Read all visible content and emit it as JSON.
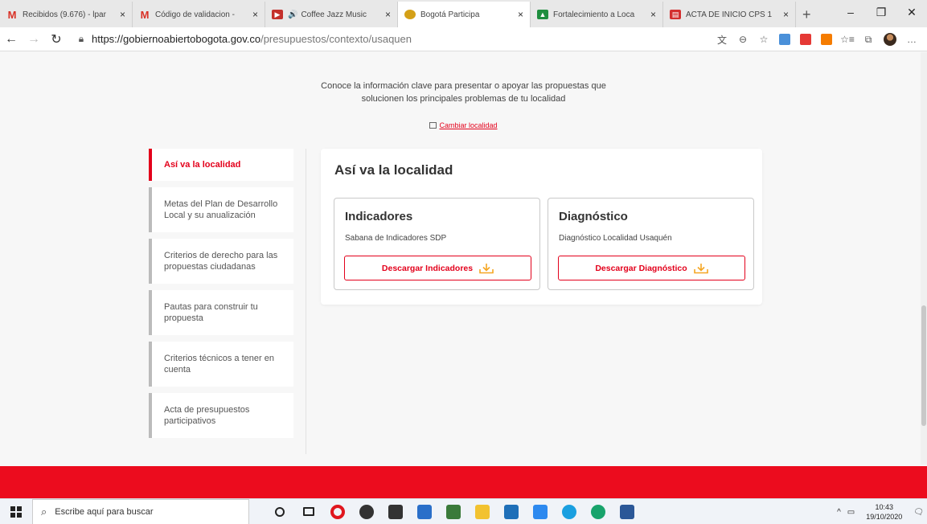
{
  "browser": {
    "tabs": [
      {
        "label": "Recibidos (9.676) - lpar",
        "icon": "gmail-icon",
        "color": "#d93025"
      },
      {
        "label": "Código de validacion -",
        "icon": "gmail-icon",
        "color": "#d93025"
      },
      {
        "label": "Coffee Jazz Music",
        "icon": "youtube-icon",
        "color": "#c4302b"
      },
      {
        "label": "Bogotá Participa",
        "icon": "bogota-icon",
        "color": "#d4a017",
        "active": true
      },
      {
        "label": "Fortalecimiento a Loca",
        "icon": "drive-icon",
        "color": "#1e8e3e"
      },
      {
        "label": "ACTA DE INICIO CPS 1",
        "icon": "pdf-icon",
        "color": "#d32f2f"
      }
    ],
    "new_tab": "+",
    "url_host": "https://gobiernoabiertobogota.gov.co",
    "url_path": "/presupuestos/contexto/usaquen"
  },
  "page": {
    "intro_line1": "Conoce la información clave para presentar o apoyar las propuestas que",
    "intro_line2": "solucionen los principales problemas de tu localidad",
    "change_locality": "Cambiar localidad",
    "sidenav": [
      {
        "label": "Así va la localidad",
        "active": true
      },
      {
        "label": "Metas del Plan de Desarrollo Local y su anualización"
      },
      {
        "label": "Criterios de derecho para las propuestas ciudadanas"
      },
      {
        "label": "Pautas para construir tu propuesta"
      },
      {
        "label": "Criterios técnicos a tener en cuenta"
      },
      {
        "label": "Acta de presupuestos participativos"
      }
    ],
    "panel_title": "Así va la localidad",
    "cards": [
      {
        "title": "Indicadores",
        "subtitle": "Sabana de Indicadores SDP",
        "button": "Descargar Indicadores"
      },
      {
        "title": "Diagnóstico",
        "subtitle": "Diagnóstico Localidad Usaquén",
        "button": "Descargar Diagnóstico"
      }
    ]
  },
  "taskbar": {
    "search_placeholder": "Escribe aquí para buscar",
    "time": "10:43",
    "date": "19/10/2020"
  },
  "colors": {
    "accent": "#e3001b",
    "footer": "#ec0c1e"
  }
}
